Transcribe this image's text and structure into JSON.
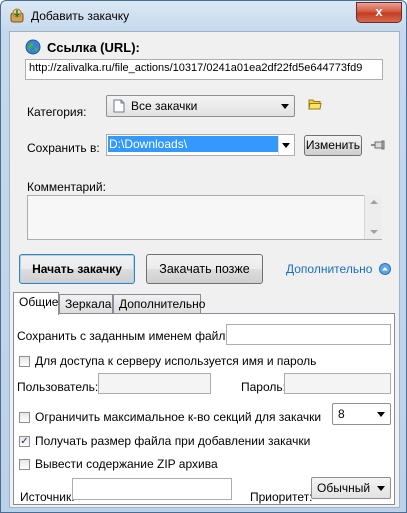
{
  "window": {
    "title": "Добавить закачку",
    "close_glyph": "x"
  },
  "url": {
    "label": "Ссылка (URL):",
    "value": "http://zalivalka.ru/file_actions/10317/0241a01ea2df22fd5e644773fd9"
  },
  "category": {
    "label": "Категория:",
    "value": "Все закачки"
  },
  "save_to": {
    "label": "Сохранить в:",
    "value": "D:\\Downloads\\",
    "change_label": "Изменить"
  },
  "comment": {
    "label": "Комментарий:",
    "value": ""
  },
  "actions": {
    "start_label": "Начать закачку",
    "later_label": "Закачать позже",
    "more_label": "Дополнительно"
  },
  "tabs": [
    {
      "label": "Общие",
      "active": true
    },
    {
      "label": "Зеркала",
      "active": false
    },
    {
      "label": "Дополнительно",
      "active": false
    }
  ],
  "general": {
    "save_as_label": "Сохранить с заданным именем файла:",
    "save_as_value": "",
    "auth_label": "Для доступа к серверу используется имя и пароль",
    "auth_checked": false,
    "user_label": "Пользователь:",
    "user_value": "",
    "password_label": "Пароль:",
    "password_value": "",
    "limit_label": "Ограничить максимальное к-во секций для закачки",
    "limit_checked": false,
    "limit_value": "8",
    "get_size_label": "Получать размер файла при добавлении закачки",
    "get_size_checked": true,
    "zip_label": "Вывести содержание ZIP архива",
    "zip_checked": false,
    "source_label": "Источник:",
    "source_value": "",
    "priority_label": "Приоритет:",
    "priority_value": "Обычный"
  },
  "colors": {
    "accent": "#3399ff",
    "link": "#1a6fbf",
    "selection": "#3399ff",
    "close_button": "#c84c33"
  },
  "icons": {
    "title": "download-add-icon",
    "globe": "globe-icon",
    "folder": "folder-icon",
    "category": "document-icon",
    "pin": "pin-icon",
    "expand": "circle-arrow-up-icon"
  }
}
